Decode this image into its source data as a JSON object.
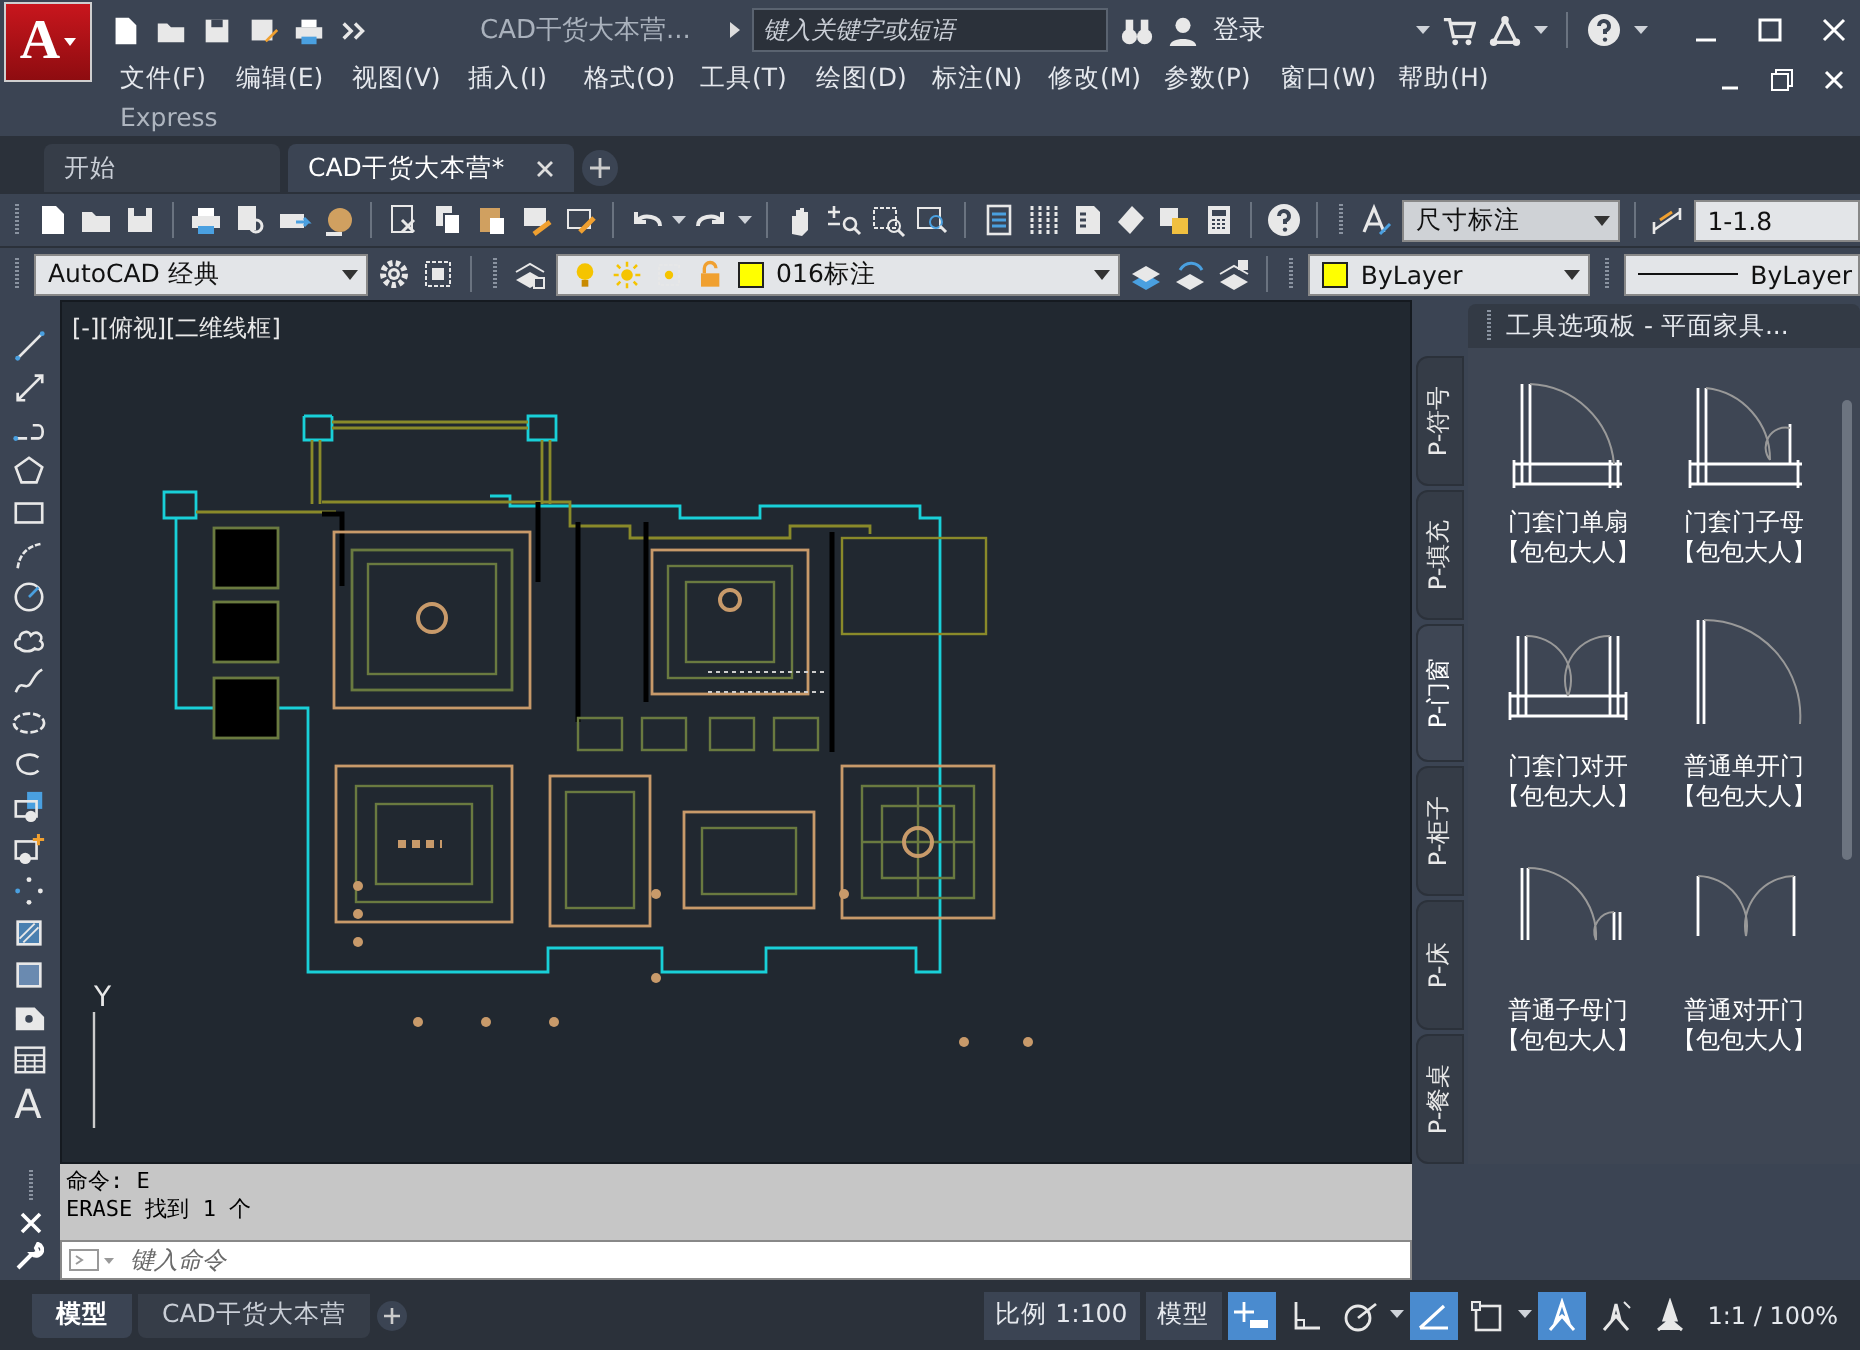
{
  "app_logo": "A",
  "title_bar": {
    "document_title": "CAD干货大本营...",
    "search": {
      "placeholder": "键入关键字或短语"
    },
    "sign_in": "登录"
  },
  "menu": [
    "文件(F)",
    "编辑(E)",
    "视图(V)",
    "插入(I)",
    "格式(O)",
    "工具(T)",
    "绘图(D)",
    "标注(N)",
    "修改(M)",
    "参数(P)",
    "窗口(W)",
    "帮助(H)",
    "Express"
  ],
  "document_tabs": [
    {
      "label": "开始",
      "selected": false,
      "closable": false
    },
    {
      "label": "CAD干货大本营*",
      "selected": true,
      "closable": true
    }
  ],
  "toolbar": {
    "dim_style": "尺寸标注",
    "dim_scale": "1-1.8"
  },
  "properties_bar": {
    "workspace": "AutoCAD 经典",
    "layer": {
      "name": "016标注",
      "color": "#ffff00"
    },
    "object_color": {
      "label": "ByLayer",
      "color": "#ffff00"
    },
    "linetype": "ByLayer"
  },
  "left_toolbar": {
    "text_glyph": "A"
  },
  "viewport": {
    "label": "[-][俯视][二维线框]",
    "ucs_axis": "Y"
  },
  "tool_palette": {
    "title": "工具选项板 - 平面家具...",
    "tabs": [
      {
        "label": "P-符号",
        "selected": false
      },
      {
        "label": "P-填充",
        "selected": false
      },
      {
        "label": "P-门窗",
        "selected": true
      },
      {
        "label": "P-柜子",
        "selected": false
      },
      {
        "label": "P-床",
        "selected": false
      },
      {
        "label": "P-餐桌",
        "selected": false
      }
    ],
    "items": [
      {
        "kind": "frame-single",
        "name": "门套门单扇",
        "author": "【包包大人】"
      },
      {
        "kind": "frame-unequal",
        "name": "门套门子母",
        "author": "【包包大人】"
      },
      {
        "kind": "frame-double",
        "name": "门套门对开",
        "author": "【包包大人】"
      },
      {
        "kind": "plain-single",
        "name": "普通单开门",
        "author": "【包包大人】"
      },
      {
        "kind": "plain-unequal",
        "name": "普通子母门",
        "author": "【包包大人】"
      },
      {
        "kind": "plain-double",
        "name": "普通对开门",
        "author": "【包包大人】"
      }
    ]
  },
  "command_line": {
    "history": [
      "命令: E",
      "ERASE 找到 1 个"
    ],
    "placeholder": "键入命令"
  },
  "status_bar": {
    "layout_tabs": [
      {
        "label": "模型",
        "selected": true
      },
      {
        "label": "CAD干货大本营",
        "selected": false
      }
    ],
    "scale": "比例 1:100",
    "space": "模型",
    "toggles": [
      {
        "kind": "snap",
        "on": true
      },
      {
        "kind": "ortho",
        "on": false
      },
      {
        "kind": "polar",
        "on": false
      },
      {
        "kind": "isodraft",
        "on": true
      },
      {
        "kind": "osnap",
        "on": false
      },
      {
        "kind": "annotation-visible",
        "on": true
      },
      {
        "kind": "auto-scale",
        "on": false
      },
      {
        "kind": "annotation-monitor",
        "on": false
      }
    ],
    "annotation_scale": "1:1 / 100%"
  }
}
